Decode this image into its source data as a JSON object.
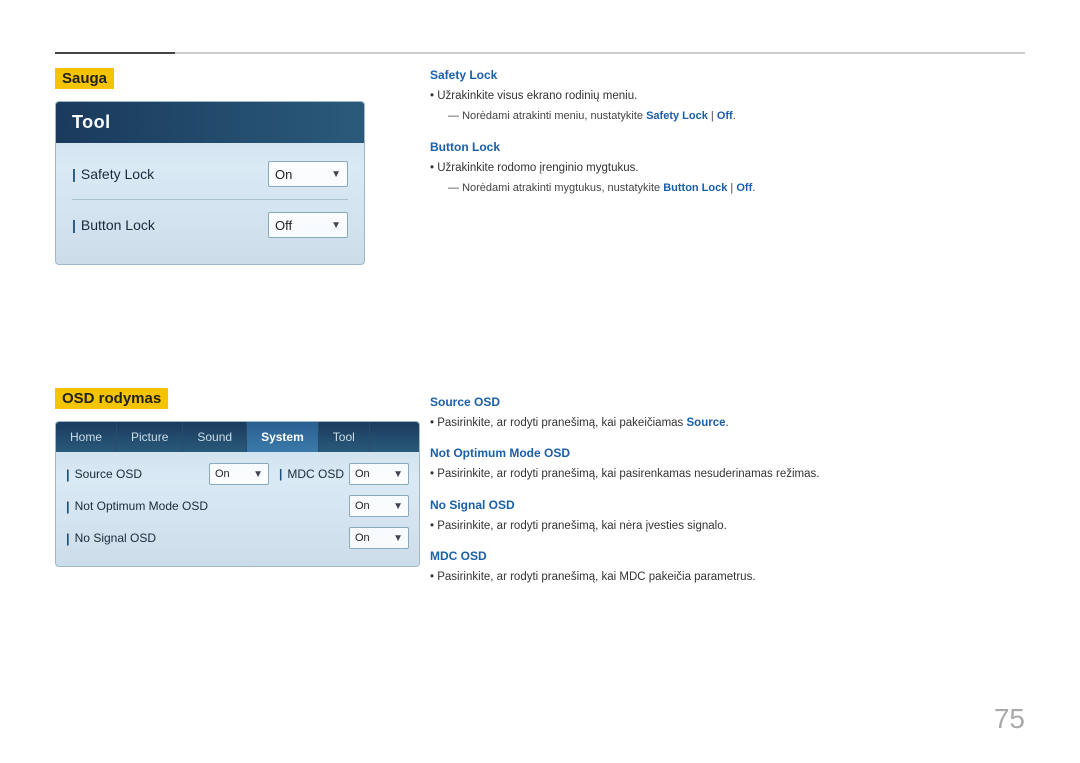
{
  "page": {
    "number": "75"
  },
  "top_line": {},
  "sauga": {
    "title": "Sauga",
    "tool_panel": {
      "header": "Tool",
      "rows": [
        {
          "label": "Safety Lock",
          "value": "On",
          "name": "safety-lock"
        },
        {
          "label": "Button Lock",
          "value": "Off",
          "name": "button-lock"
        }
      ]
    },
    "description": {
      "safety_lock": {
        "title": "Safety Lock",
        "bullet": "Užrakinkite visus ekrano rodinių meniu.",
        "indent": "Norėdami atrakinti meniu, nustatykite Safety Lock | Off."
      },
      "button_lock": {
        "title": "Button Lock",
        "bullet": "Užrakinkite rodomo įrenginio mygtukus.",
        "indent": "Norėdami atrakinti mygtukus, nustatykite Button Lock | Off."
      }
    }
  },
  "osd": {
    "title": "OSD rodymas",
    "panel": {
      "tabs": [
        {
          "label": "Home",
          "active": false
        },
        {
          "label": "Picture",
          "active": false
        },
        {
          "label": "Sound",
          "active": false
        },
        {
          "label": "System",
          "active": true
        },
        {
          "label": "Tool",
          "active": false
        }
      ],
      "rows": [
        {
          "label": "Source OSD",
          "value": "On",
          "right_label": "MDC OSD",
          "right_value": "On"
        },
        {
          "label": "Not Optimum Mode OSD",
          "value": "On",
          "right_label": null,
          "right_value": null
        },
        {
          "label": "No Signal OSD",
          "value": "On",
          "right_label": null,
          "right_value": null
        }
      ]
    },
    "description": {
      "source_osd": {
        "title": "Source OSD",
        "bullet": "Pasirinkite, ar rodyti pranešimą, kai pakeičiamas Source."
      },
      "not_optimum": {
        "title": "Not Optimum Mode OSD",
        "bullet": "Pasirinkite, ar rodyti pranešimą, kai pasirenkamas nesuderinamas režimas."
      },
      "no_signal": {
        "title": "No Signal OSD",
        "bullet": "Pasirinkite, ar rodyti pranešimą, kai nėra įvesties signalo."
      },
      "mdc_osd": {
        "title": "MDC OSD",
        "bullet": "Pasirinkite, ar rodyti pranešimą, kai MDC pakeičia parametrus."
      }
    }
  }
}
